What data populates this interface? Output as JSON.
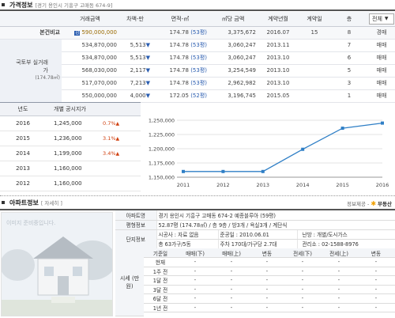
{
  "price_section": {
    "title": "가격정보",
    "address": "[경기 용인시 기흥구 고매동 674-9]",
    "filter_selected": "전체",
    "columns": [
      "거래금액",
      "차액-만",
      "면적-㎡",
      "㎡당 금액",
      "계약년월",
      "계약일",
      "층"
    ],
    "row_labels": {
      "own": "본건비교",
      "gov": "국토부 실거래가",
      "gov_area": "(174.78㎡)"
    },
    "rows": [
      {
        "price": "590,000,000",
        "diff": "",
        "area": "174.78",
        "pyeong": "(53평)",
        "unit_price": "3,375,672",
        "ym": "2016.07",
        "day": "15",
        "floor": "8",
        "type": "경매",
        "badge": "감"
      },
      {
        "price": "534,870,000",
        "diff": "5,513",
        "area": "174.78",
        "pyeong": "(53평)",
        "unit_price": "3,060,247",
        "ym": "2013.11",
        "day": "",
        "floor": "7",
        "type": "매매"
      },
      {
        "price": "534,870,000",
        "diff": "5,513",
        "area": "174.78",
        "pyeong": "(53평)",
        "unit_price": "3,060,247",
        "ym": "2013.10",
        "day": "",
        "floor": "6",
        "type": "매매"
      },
      {
        "price": "568,030,000",
        "diff": "2,117",
        "area": "174.78",
        "pyeong": "(53평)",
        "unit_price": "3,254,549",
        "ym": "2013.10",
        "day": "",
        "floor": "5",
        "type": "매매"
      },
      {
        "price": "517,070,000",
        "diff": "7,213",
        "area": "174.78",
        "pyeong": "(53평)",
        "unit_price": "2,962,982",
        "ym": "2013.10",
        "day": "",
        "floor": "3",
        "type": "매매"
      },
      {
        "price": "550,000,000",
        "diff": "4,000",
        "area": "172.05",
        "pyeong": "(52평)",
        "unit_price": "3,196,745",
        "ym": "2015.05",
        "day": "",
        "floor": "1",
        "type": "매매"
      }
    ]
  },
  "official_price": {
    "columns": [
      "년도",
      "개별 공시지가"
    ],
    "rows": [
      {
        "year": "2016",
        "price": "1,245,000",
        "pct": "0.7%"
      },
      {
        "year": "2015",
        "price": "1,236,000",
        "pct": "3.1%"
      },
      {
        "year": "2014",
        "price": "1,199,000",
        "pct": "3.4%"
      },
      {
        "year": "2013",
        "price": "1,160,000",
        "pct": ""
      },
      {
        "year": "2012",
        "price": "1,160,000",
        "pct": ""
      }
    ]
  },
  "chart_data": {
    "type": "line",
    "x": [
      "2011",
      "2012",
      "2013",
      "2014",
      "2015",
      "2016"
    ],
    "values": [
      1160000,
      1160000,
      1160000,
      1199000,
      1236000,
      1245000
    ],
    "y_ticks": [
      "1,150,000",
      "1,175,000",
      "1,200,000",
      "1,225,000",
      "1,250,000"
    ],
    "ylim": [
      1150000,
      1250000
    ],
    "line_color": "#2f7fc6",
    "grid": true
  },
  "apt_section": {
    "title": "아파트정보",
    "detail_link": "[ 자세히 ]",
    "source": "정보제공 -",
    "source_brand": "부동산",
    "photo_caption": "이미지 준비중입니다.",
    "labels": {
      "name": "아파트명",
      "pyeong": "평형정보",
      "complex": "단지정보",
      "market": "시세 (만원)"
    },
    "name": "경기 용인시 기흥구 고매동 674-2 예종블루아 (59평)",
    "pyeong": "52.87평 (174.78㎡) / 층 9층 / 방3개 / 욕실3개 / 계단식",
    "builder": "시공사 : 자료 없음",
    "completed": "준공일 : 2010.06.01",
    "heating": "난방 : 개별/도시가스",
    "households": "총 63가구/5동",
    "parking": "주차 170대/가구당 2.7대",
    "office": "관리소 : 02-1588-8976",
    "market_columns": [
      "기준일",
      "매매(下)",
      "매매(上)",
      "변동",
      "전세(下)",
      "전세(上)",
      "변동"
    ],
    "market_rows": [
      {
        "date": "현재",
        "v": [
          "-",
          "-",
          "-",
          "-",
          "-",
          "-"
        ]
      },
      {
        "date": "1주 전",
        "v": [
          "-",
          "-",
          "-",
          "-",
          "-",
          "-"
        ]
      },
      {
        "date": "1달 전",
        "v": [
          "-",
          "-",
          "-",
          "-",
          "-",
          "-"
        ]
      },
      {
        "date": "3달 전",
        "v": [
          "-",
          "-",
          "-",
          "-",
          "-",
          "-"
        ]
      },
      {
        "date": "6달 전",
        "v": [
          "-",
          "-",
          "-",
          "-",
          "-",
          "-"
        ]
      },
      {
        "date": "1년 전",
        "v": [
          "-",
          "-",
          "-",
          "-",
          "-",
          "-"
        ]
      }
    ]
  }
}
